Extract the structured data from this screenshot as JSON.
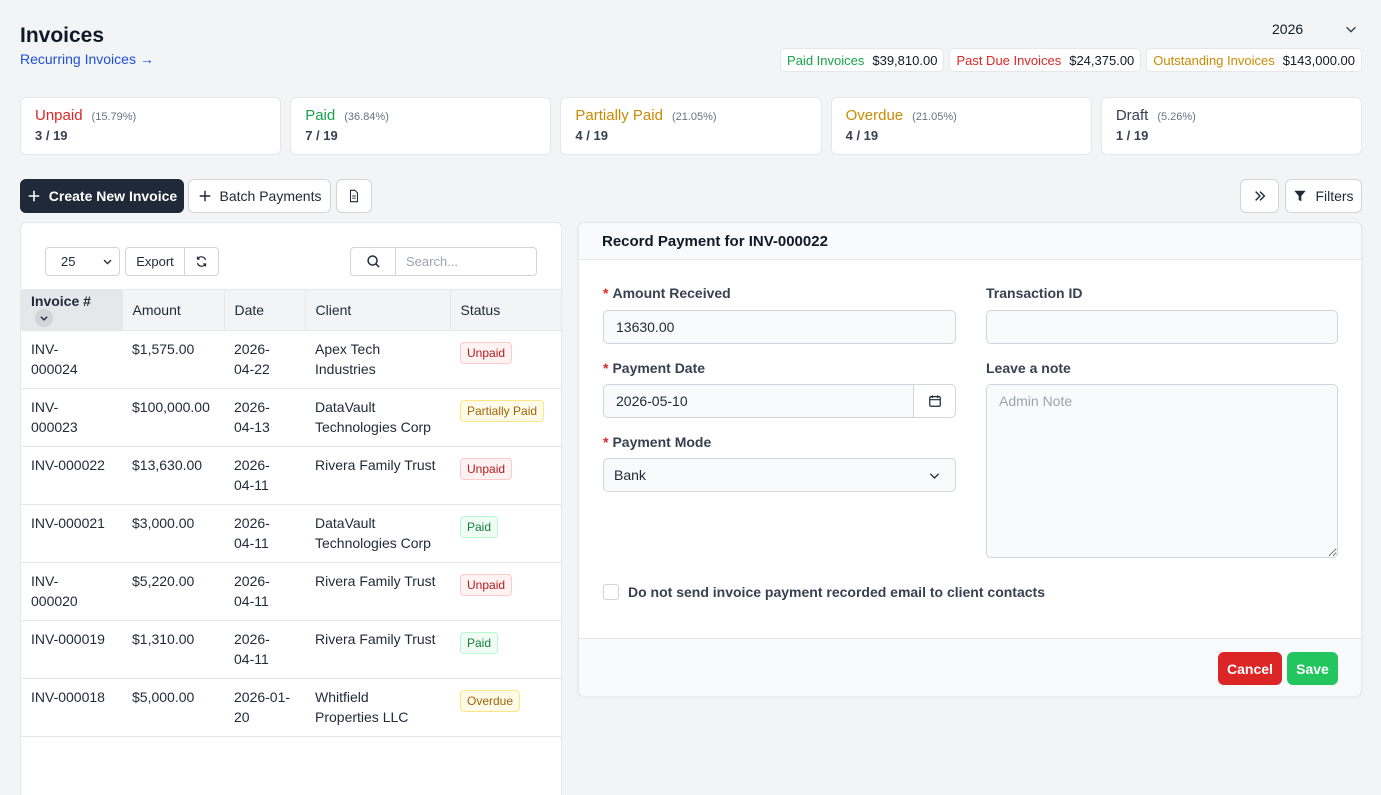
{
  "header": {
    "title": "Invoices",
    "recurring_link": "Recurring Invoices →",
    "year": "2026"
  },
  "totals": [
    {
      "label": "Paid Invoices",
      "amount": "$39,810.00",
      "color": "#16a34a"
    },
    {
      "label": "Past Due Invoices",
      "amount": "$24,375.00",
      "color": "#dc2626"
    },
    {
      "label": "Outstanding Invoices",
      "amount": "$143,000.00",
      "color": "#ca8a04"
    }
  ],
  "stats": [
    {
      "name": "Unpaid",
      "pct": "(15.79%)",
      "count": "3 / 19",
      "color": "#dc2626"
    },
    {
      "name": "Paid",
      "pct": "(36.84%)",
      "count": "7 / 19",
      "color": "#16a34a"
    },
    {
      "name": "Partially Paid",
      "pct": "(21.05%)",
      "count": "4 / 19",
      "color": "#ca8a04"
    },
    {
      "name": "Overdue",
      "pct": "(21.05%)",
      "count": "4 / 19",
      "color": "#ca8a04"
    },
    {
      "name": "Draft",
      "pct": "(5.26%)",
      "count": "1 / 19",
      "color": "#374151"
    }
  ],
  "toolbar": {
    "create_label": "Create New Invoice",
    "batch_label": "Batch Payments",
    "filters_label": "Filters"
  },
  "list": {
    "per_page": "25",
    "export_label": "Export",
    "search_placeholder": "Search...",
    "columns": [
      "Invoice #",
      "Amount",
      "Date",
      "Client",
      "Status"
    ],
    "rows": [
      {
        "invoice": "INV-\n000024",
        "amount": "$1,575.00",
        "date": "2026-\n04-22",
        "client": "Apex Tech\nIndustries",
        "status": "Unpaid"
      },
      {
        "invoice": "INV-\n000023",
        "amount": "$100,000.00",
        "date": "2026-\n04-13",
        "client": "DataVault\nTechnologies Corp",
        "status": "Partially Paid"
      },
      {
        "invoice": "INV-000022",
        "amount": "$13,630.00",
        "date": "2026-\n04-11",
        "client": "Rivera Family Trust",
        "status": "Unpaid"
      },
      {
        "invoice": "INV-000021",
        "amount": "$3,000.00",
        "date": "2026-\n04-11",
        "client": "DataVault\nTechnologies Corp",
        "status": "Paid"
      },
      {
        "invoice": "INV-\n000020",
        "amount": "$5,220.00",
        "date": "2026-\n04-11",
        "client": "Rivera Family Trust",
        "status": "Unpaid"
      },
      {
        "invoice": "INV-000019",
        "amount": "$1,310.00",
        "date": "2026-\n04-11",
        "client": "Rivera Family Trust",
        "status": "Paid"
      },
      {
        "invoice": "INV-000018",
        "amount": "$5,000.00",
        "date": "2026-01-\n20",
        "client": "Whitfield\nProperties LLC",
        "status": "Overdue"
      }
    ]
  },
  "payment": {
    "title": "Record Payment for INV-000022",
    "amount_label": "Amount Received",
    "amount_value": "13630.00",
    "transaction_label": "Transaction ID",
    "transaction_value": "",
    "date_label": "Payment Date",
    "date_value": "2026-05-10",
    "mode_label": "Payment Mode",
    "mode_value": "Bank",
    "note_label": "Leave a note",
    "note_placeholder": "Admin Note",
    "checkbox_label": "Do not send invoice payment recorded email to client contacts",
    "cancel_label": "Cancel",
    "save_label": "Save"
  }
}
